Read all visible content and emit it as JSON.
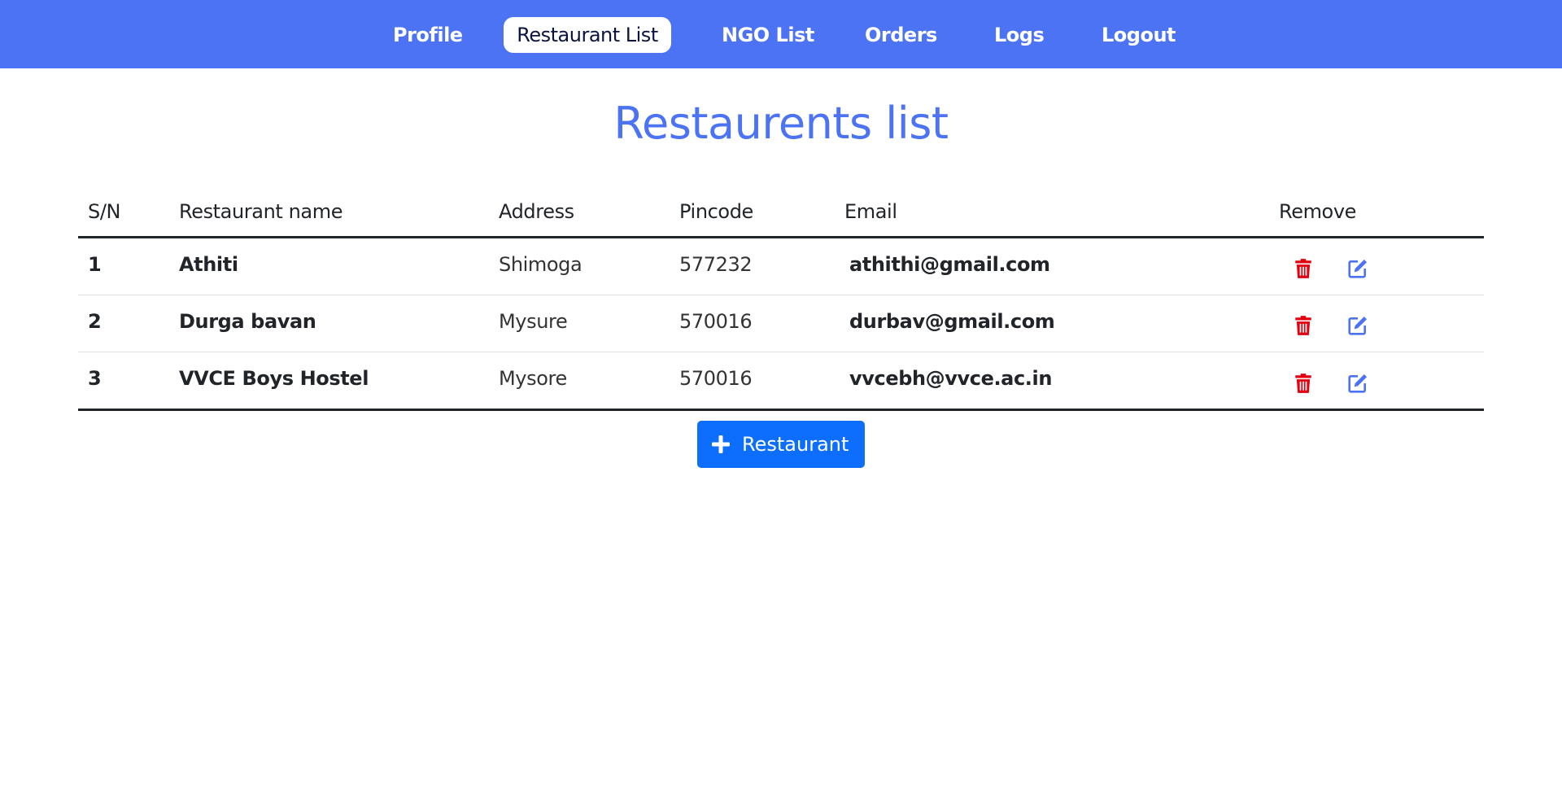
{
  "nav": {
    "profile": "Profile",
    "restaurant_list": "Restaurant List",
    "ngo_list": "NGO List",
    "orders": "Orders",
    "logs": "Logs",
    "logout": "Logout"
  },
  "page": {
    "title": "Restaurents list"
  },
  "table": {
    "headers": {
      "sn": "S/N",
      "name": "Restaurant name",
      "address": "Address",
      "pincode": "Pincode",
      "email": "Email",
      "remove": "Remove"
    },
    "rows": [
      {
        "sn": "1",
        "name": "Athiti",
        "address": "Shimoga",
        "pincode": "577232",
        "email": "athithi@gmail.com"
      },
      {
        "sn": "2",
        "name": "Durga bavan",
        "address": "Mysure",
        "pincode": "570016",
        "email": "durbav@gmail.com"
      },
      {
        "sn": "3",
        "name": "VVCE Boys Hostel",
        "address": "Mysore",
        "pincode": "570016",
        "email": "vvcebh@vvce.ac.in"
      }
    ]
  },
  "actions": {
    "add_restaurant_label": "Restaurant",
    "add_icon": "plus-icon",
    "delete_icon": "trash-icon",
    "edit_icon": "edit-icon"
  },
  "colors": {
    "brand": "#4d73f5",
    "primary_button": "#0d6efd",
    "delete": "#e3000f",
    "edit": "#4d73f5"
  }
}
